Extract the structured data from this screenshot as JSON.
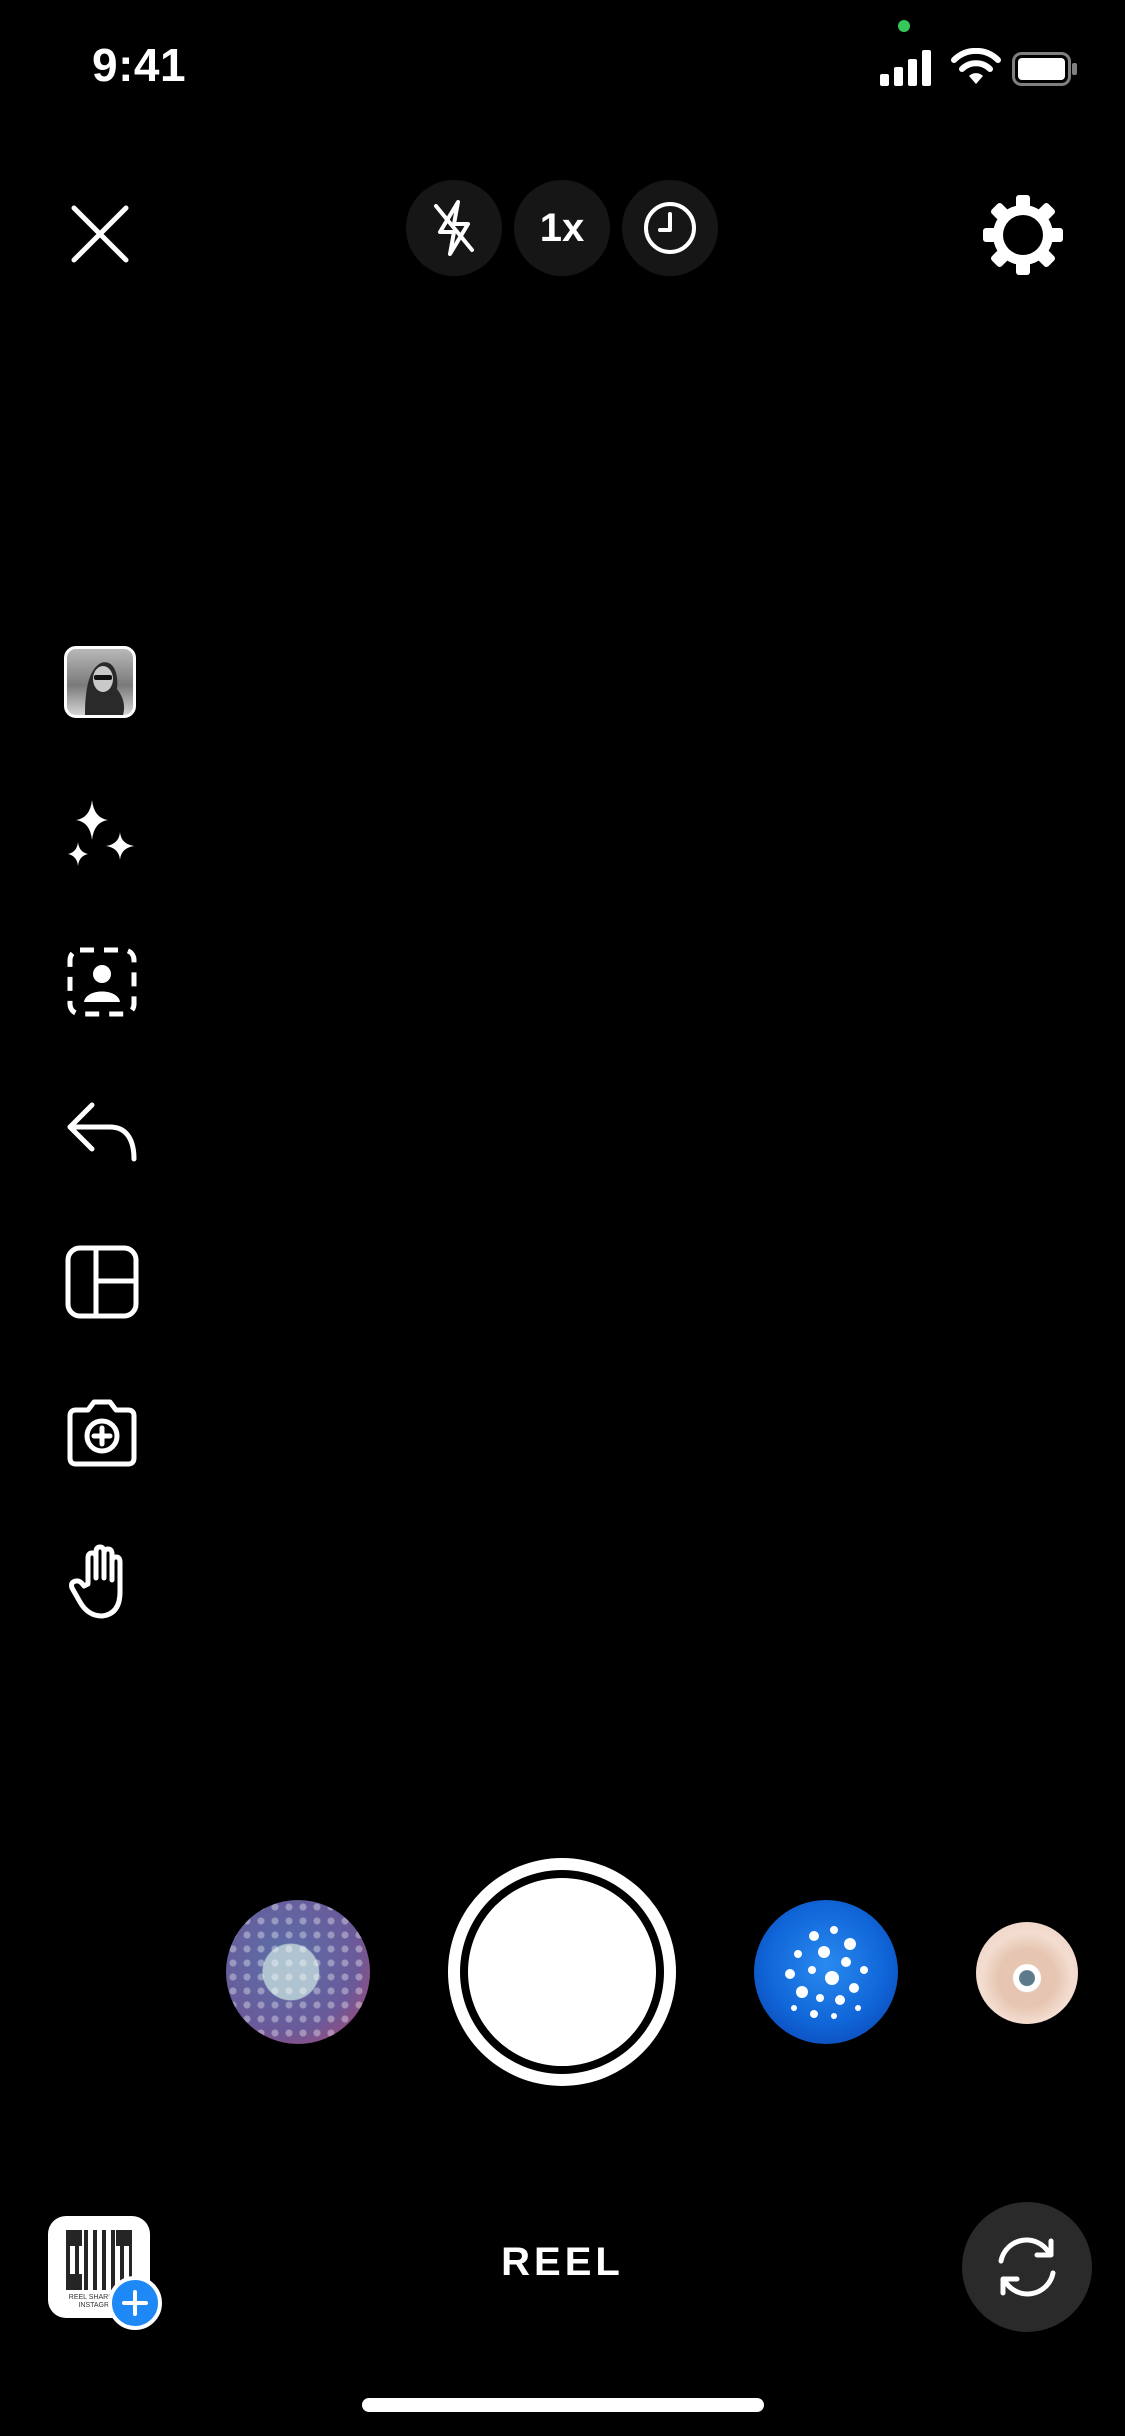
{
  "status_bar": {
    "time": "9:41"
  },
  "top_controls": {
    "zoom_label": "1x"
  },
  "left_tools": [
    "photo-thumbnail",
    "sparkles-icon",
    "person-frame-icon",
    "reply-arrow-icon",
    "layout-icon",
    "camera-plus-icon",
    "hand-icon"
  ],
  "bottom": {
    "mode_label": "REEL",
    "qr_caption": "REEL SHARED BY INSTAGRAM"
  },
  "colors": {
    "background": "#000000",
    "accent_blue": "#1e88f7",
    "status_dot": "#34c759"
  }
}
